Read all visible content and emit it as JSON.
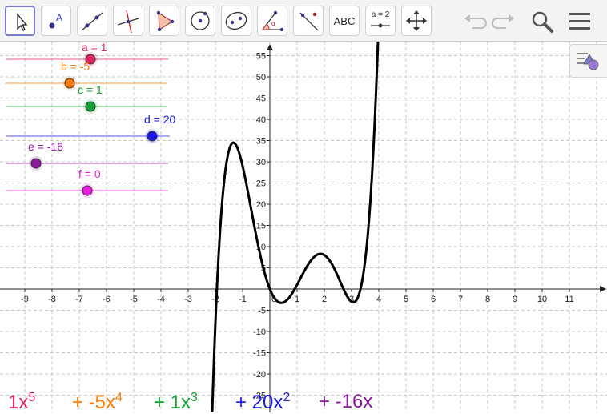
{
  "toolbar": {
    "text_tool_label": "ABC",
    "slider_tool_label": "a = 2"
  },
  "graph": {
    "x_ticks": [
      "-9",
      "-8",
      "-7",
      "-6",
      "-5",
      "-4",
      "-3",
      "-2",
      "-1",
      "0",
      "1",
      "2",
      "3",
      "4",
      "5",
      "6",
      "7",
      "8",
      "9",
      "10",
      "11"
    ],
    "y_ticks": [
      "55",
      "50",
      "45",
      "40",
      "35",
      "30",
      "25",
      "20",
      "15",
      "10",
      "5",
      "-5",
      "-10",
      "-15",
      "-20",
      "-25"
    ]
  },
  "sliders": [
    {
      "label": "a = 1",
      "value": 1,
      "color": "#e0245e"
    },
    {
      "label": "b = -5",
      "value": -5,
      "color": "#ff7a00"
    },
    {
      "label": "c = 1",
      "value": 1,
      "color": "#12a032"
    },
    {
      "label": "d = 20",
      "value": 20,
      "color": "#1a1ae6"
    },
    {
      "label": "e = -16",
      "value": -16,
      "color": "#8a1a9a"
    },
    {
      "label": "f = 0",
      "value": 0,
      "color": "#e81ee0"
    }
  ],
  "formula": {
    "t1_coef": "1x",
    "t1_exp": "5",
    "t2_coef": "+ -5x",
    "t2_exp": "4",
    "t3_coef": "+ 1x",
    "t3_exp": "3",
    "t4_coef": "+ 20x",
    "t4_exp": "2",
    "t5": "+ -16x"
  }
}
